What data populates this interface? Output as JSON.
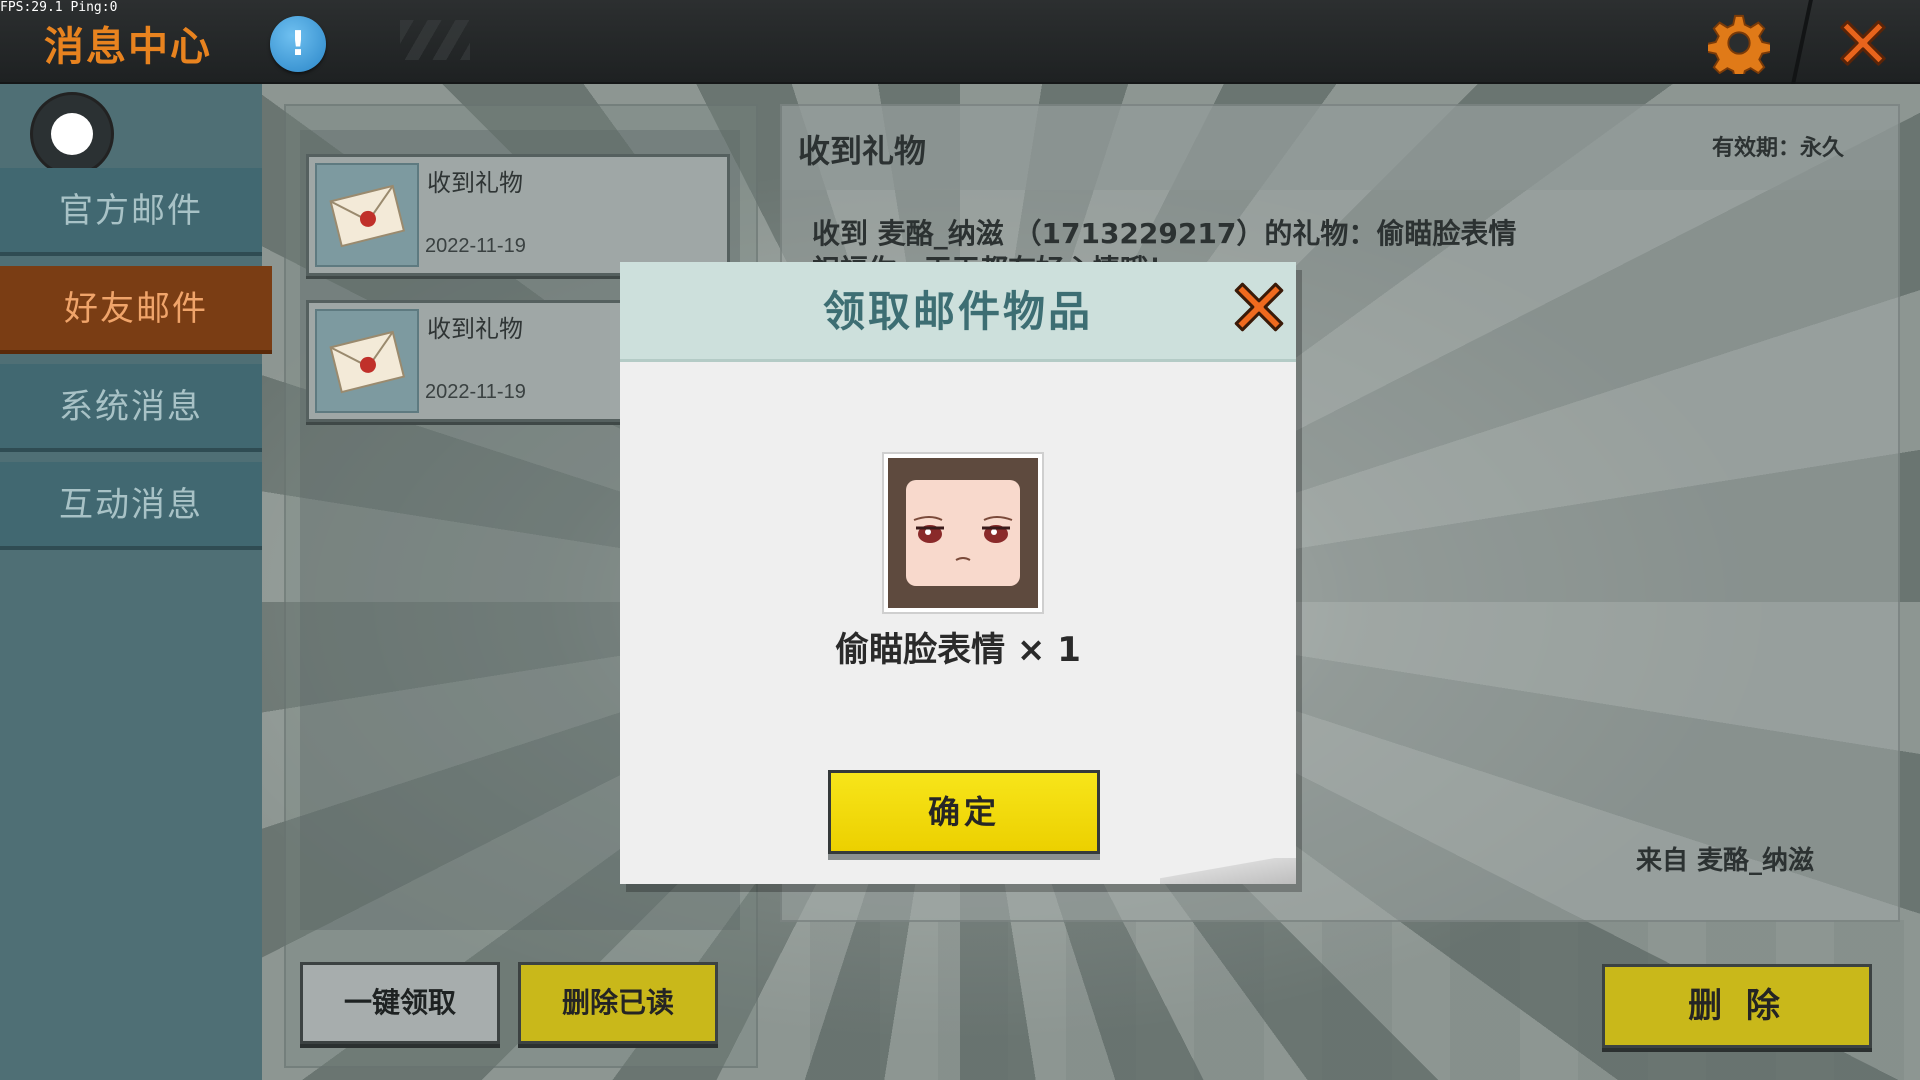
{
  "debug": {
    "fps_text": "FPS:29.1  Ping:0"
  },
  "header": {
    "title": "消息中心",
    "info_symbol": "!"
  },
  "sidebar": {
    "items": [
      {
        "label": "官方邮件",
        "active": false
      },
      {
        "label": "好友邮件",
        "active": true
      },
      {
        "label": "系统消息",
        "active": false
      },
      {
        "label": "互动消息",
        "active": false
      }
    ]
  },
  "mail_list": {
    "items": [
      {
        "title": "收到礼物",
        "date": "2022-11-19"
      },
      {
        "title": "收到礼物",
        "date": "2022-11-19"
      }
    ],
    "claim_all_label": "一键领取",
    "delete_read_label": "删除已读"
  },
  "detail": {
    "title": "收到礼物",
    "validity": "有效期：永久",
    "body": "收到   麦酪_纳滋   （1713229217）的礼物：偷瞄脸表情",
    "body_line2": "祝福你，天天都有好心情哦！",
    "from": "来自    麦酪_纳滋",
    "delete_label": "删 除"
  },
  "modal": {
    "title": "领取邮件物品",
    "item_name": "偷瞄脸表情 × 1",
    "confirm_label": "确定"
  },
  "colors": {
    "accent_orange": "#e8831f",
    "active_tab": "#7a3d14",
    "confirm_yellow": "#f7e51a",
    "info_blue": "#2a86c8"
  }
}
